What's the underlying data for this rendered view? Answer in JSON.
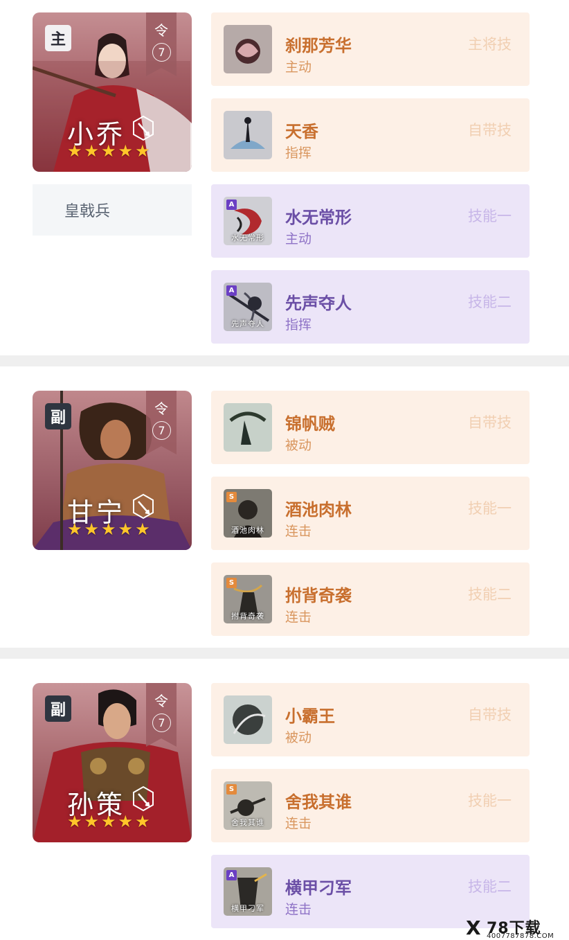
{
  "heroes": [
    {
      "role_badge": "主",
      "ling_char": "令",
      "ling_num": "7",
      "name": "小乔",
      "stars": [
        "★",
        "★",
        "★",
        "★",
        "★"
      ],
      "troop": "皇戟兵",
      "skills": [
        {
          "name": "刹那芳华",
          "type": "主动",
          "slot": "主将技",
          "grade": "",
          "caption": ""
        },
        {
          "name": "天香",
          "type": "指挥",
          "slot": "自带技",
          "grade": "",
          "caption": ""
        },
        {
          "name": "水无常形",
          "type": "主动",
          "slot": "技能一",
          "grade": "A",
          "caption": "水无常形"
        },
        {
          "name": "先声夺人",
          "type": "指挥",
          "slot": "技能二",
          "grade": "A",
          "caption": "先声夺人"
        }
      ]
    },
    {
      "role_badge": "副",
      "ling_char": "令",
      "ling_num": "7",
      "name": "甘宁",
      "stars": [
        "★",
        "★",
        "★",
        "★",
        "★"
      ],
      "skills": [
        {
          "name": "锦帆贼",
          "type": "被动",
          "slot": "自带技",
          "grade": "",
          "caption": ""
        },
        {
          "name": "酒池肉林",
          "type": "连击",
          "slot": "技能一",
          "grade": "S",
          "caption": "酒池肉林"
        },
        {
          "name": "拊背奇袭",
          "type": "连击",
          "slot": "技能二",
          "grade": "S",
          "caption": "拊背奇袭"
        }
      ]
    },
    {
      "role_badge": "副",
      "ling_char": "令",
      "ling_num": "7",
      "name": "孙策",
      "stars": [
        "★",
        "★",
        "★",
        "★",
        "★"
      ],
      "skills": [
        {
          "name": "小霸王",
          "type": "被动",
          "slot": "自带技",
          "grade": "",
          "caption": ""
        },
        {
          "name": "舍我其谁",
          "type": "连击",
          "slot": "技能一",
          "grade": "S",
          "caption": "舍我其谁"
        },
        {
          "name": "横甲刁军",
          "type": "连击",
          "slot": "技能二",
          "grade": "A",
          "caption": "横甲刁军"
        }
      ]
    }
  ],
  "watermark": {
    "mark": "X",
    "title": "78下载",
    "url": "4007787878.COM"
  },
  "colors": {
    "orange_bg": "#fdf0e6",
    "purple_bg": "#ece5f8",
    "orange_text": "#c86f2e",
    "purple_text": "#6b4fa6",
    "star": "#ffc62a",
    "divider": "#efefef"
  },
  "icons": [
    "spear-icon",
    "star-icon",
    "skill-icon"
  ]
}
